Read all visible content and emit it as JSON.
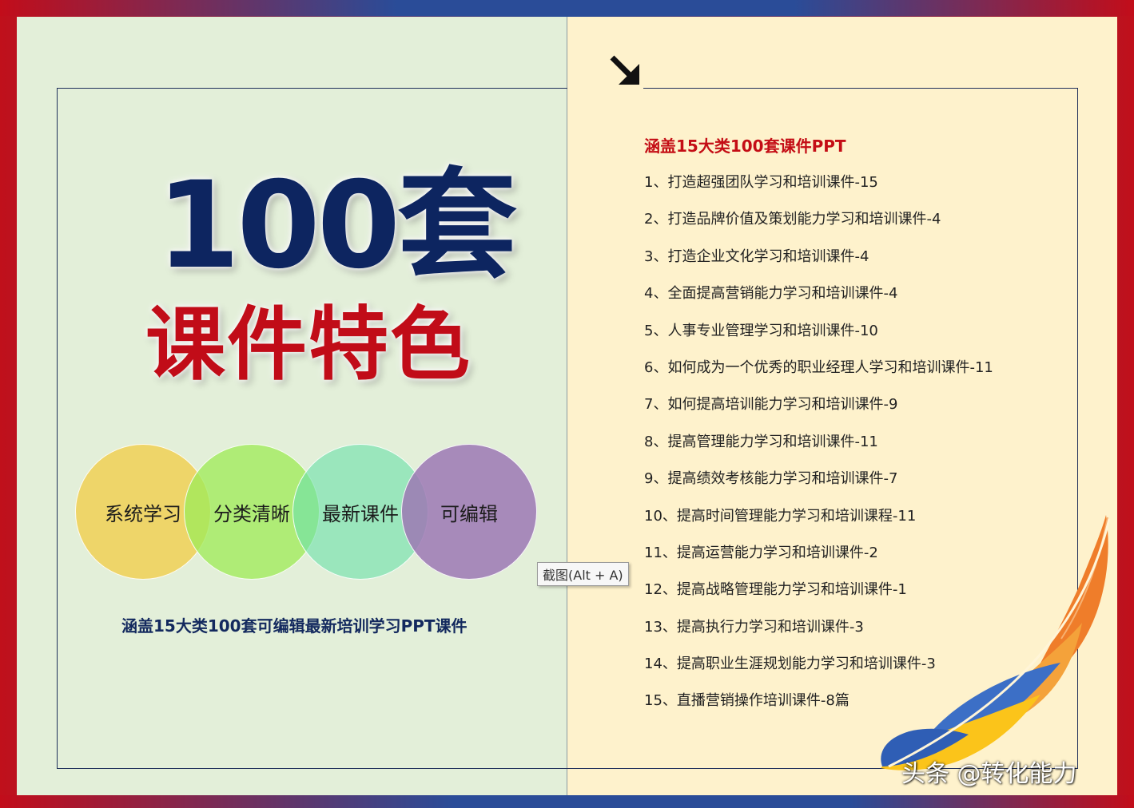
{
  "hero": {
    "number": "100套",
    "title": "课件特色"
  },
  "features": [
    {
      "label": "系统学习"
    },
    {
      "label": "分类清晰"
    },
    {
      "label": "最新课件"
    },
    {
      "label": "可编辑"
    }
  ],
  "left_caption": "涵盖15大类100套可编辑最新培训学习PPT课件",
  "tooltip": "截图(Alt + A)",
  "list": {
    "title": "涵盖15大类100套课件PPT",
    "items": [
      "1、打造超强团队学习和培训课件-15",
      "2、打造品牌价值及策划能力学习和培训课件-4",
      "3、打造企业文化学习和培训课件-4",
      "4、全面提高营销能力学习和培训课件-4",
      "5、人事专业管理学习和培训课件-10",
      "6、如何成为一个优秀的职业经理人学习和培训课件-11",
      "7、如何提高培训能力学习和培训课件-9",
      "8、提高管理能力学习和培训课件-11",
      "9、提高绩效考核能力学习和培训课件-7",
      "10、提高时间管理能力学习和培训课程-11",
      "11、提高运营能力学习和培训课件-2",
      "12、提高战略管理能力学习和培训课件-1",
      "13、提高执行力学习和培训课件-3",
      "14、提高职业生涯规划能力学习和培训课件-3",
      "15、直播营销操作培训课件-8篇"
    ]
  },
  "watermark": "头条 @转化能力",
  "icons": {
    "arrow": "arrow-down-right-icon",
    "feather": "feather-icon"
  },
  "colors": {
    "navy": "#0d2560",
    "red": "#c10c18",
    "left_bg": "#e3efd9",
    "right_bg": "#fef2cc"
  }
}
